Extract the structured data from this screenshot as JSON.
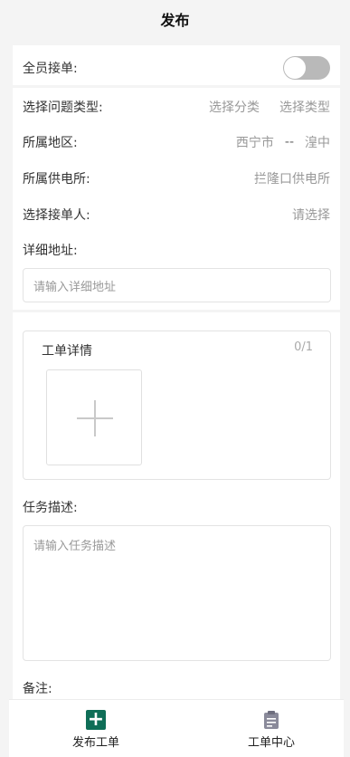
{
  "header": {
    "title": "发布"
  },
  "form": {
    "all_staff": {
      "label": "全员接单:",
      "enabled": false
    },
    "problem_type": {
      "label": "选择问题类型:",
      "category_placeholder": "选择分类",
      "type_placeholder": "选择类型"
    },
    "region": {
      "label": "所属地区:",
      "city": "西宁市",
      "separator": "--",
      "district": "湟中"
    },
    "power_station": {
      "label": "所属供电所:",
      "value": "拦隆口供电所"
    },
    "receiver": {
      "label": "选择接单人:",
      "placeholder": "请选择"
    },
    "address": {
      "label": "详细地址:",
      "placeholder": "请输入详细地址"
    },
    "order_detail": {
      "title": "工单详情",
      "count": "0/1"
    },
    "task_description": {
      "label": "任务描述:",
      "placeholder": "请输入任务描述"
    },
    "remark": {
      "label": "备注:"
    }
  },
  "tabbar": {
    "items": [
      {
        "label": "发布工单",
        "icon": "add-square-icon",
        "color": "#0f6e57"
      },
      {
        "label": "工单中心",
        "icon": "clipboard-icon",
        "color": "#8a8a9a"
      }
    ]
  }
}
